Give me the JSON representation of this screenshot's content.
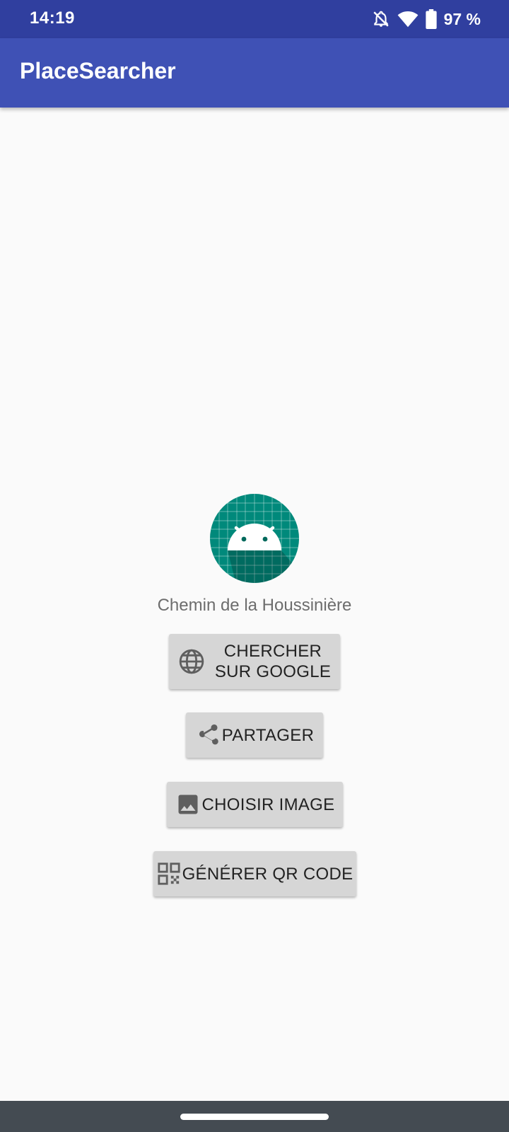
{
  "status_bar": {
    "time": "14:19",
    "battery": "97 %",
    "icons": [
      "notifications-off-icon",
      "wifi-icon",
      "battery-icon"
    ]
  },
  "app_bar": {
    "title": "PlaceSearcher"
  },
  "place": {
    "icon": "android-icon",
    "name": "Chemin de la Houssinière"
  },
  "actions": {
    "google": {
      "label": "CHERCHER\nSUR GOOGLE",
      "icon": "globe-icon"
    },
    "share": {
      "label": "PARTAGER",
      "icon": "share-icon"
    },
    "image": {
      "label": "CHOISIR IMAGE",
      "icon": "image-icon"
    },
    "qr": {
      "label": "GÉNÉRER QR CODE",
      "icon": "qr-code-icon"
    }
  },
  "colors": {
    "status_bar": "#303f9f",
    "app_bar": "#3f51b5",
    "background": "#fafafa",
    "button": "#d6d6d6",
    "icon_teal": "#00897b",
    "nav_bar": "#444b52"
  }
}
